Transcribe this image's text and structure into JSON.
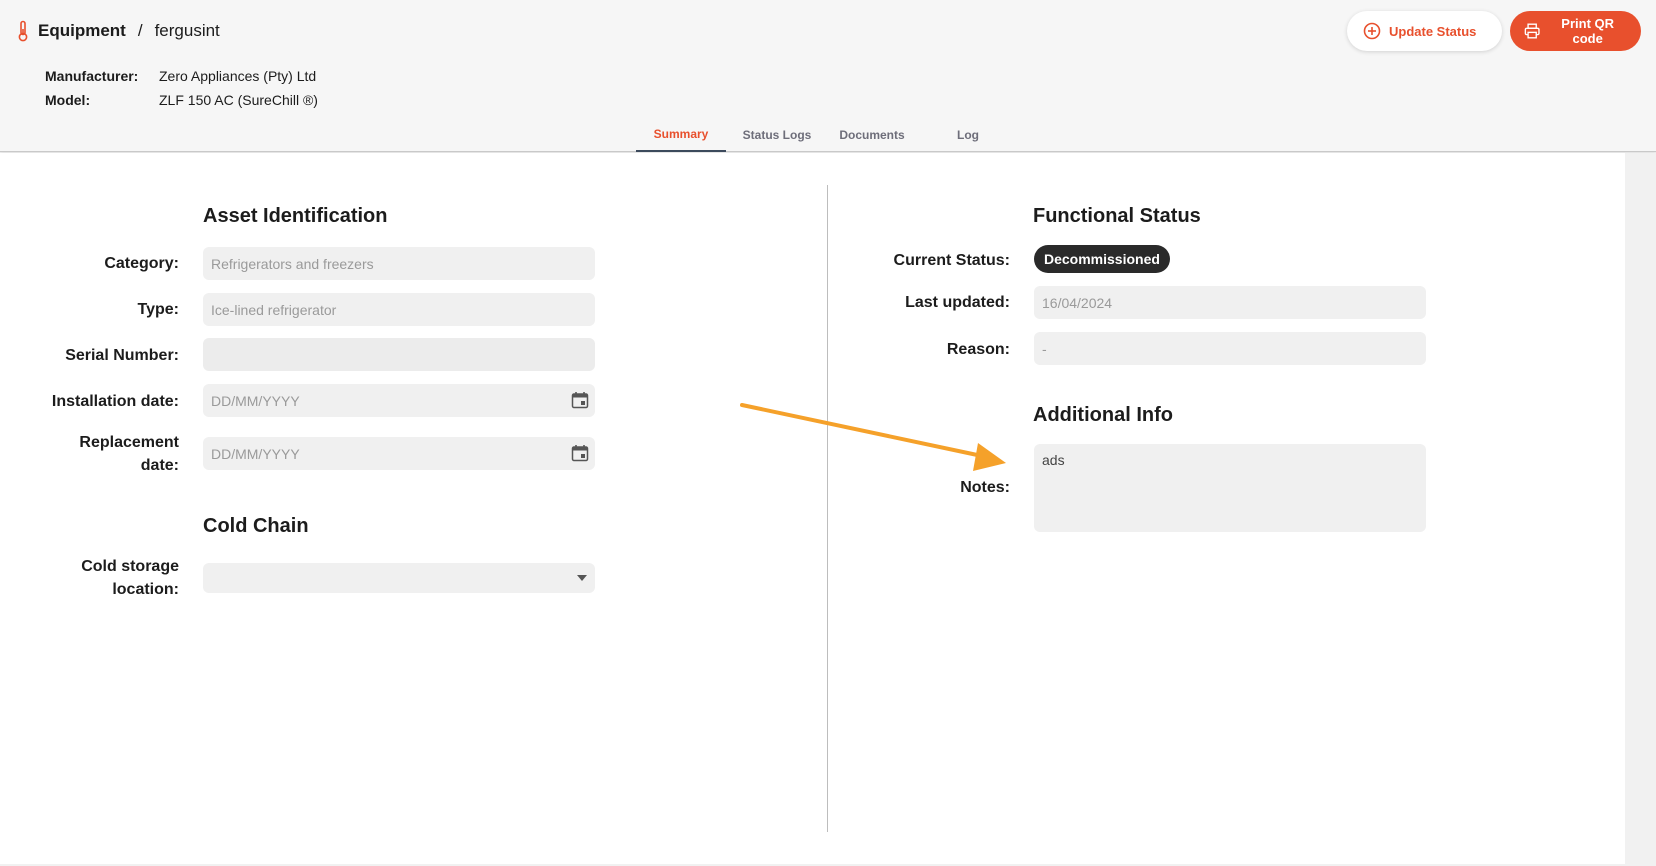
{
  "breadcrumb": {
    "root": "Equipment",
    "separator": "/",
    "current": "fergusint"
  },
  "meta": {
    "manufacturer_label": "Manufacturer:",
    "manufacturer_value": "Zero Appliances (Pty) Ltd",
    "model_label": "Model:",
    "model_value": "ZLF 150 AC (SureChill ®)"
  },
  "actions": {
    "update_status": "Update Status",
    "print_qr": "Print QR code"
  },
  "tabs": [
    {
      "label": "Summary",
      "active": true
    },
    {
      "label": "Status Logs",
      "active": false
    },
    {
      "label": "Documents",
      "active": false
    },
    {
      "label": "Log",
      "active": false
    }
  ],
  "asset": {
    "title": "Asset Identification",
    "category_label": "Category:",
    "category_value": "Refrigerators and freezers",
    "type_label": "Type:",
    "type_value": "Ice-lined refrigerator",
    "serial_label": "Serial Number:",
    "serial_value": "",
    "installation_label": "Installation date:",
    "installation_placeholder": "DD/MM/YYYY",
    "replacement_label_1": "Replacement",
    "replacement_label_2": "date:",
    "replacement_placeholder": "DD/MM/YYYY"
  },
  "cold_chain": {
    "title": "Cold Chain",
    "location_label_1": "Cold storage",
    "location_label_2": "location:",
    "location_value": ""
  },
  "functional": {
    "title": "Functional Status",
    "current_label": "Current Status:",
    "current_value": "Decommissioned",
    "updated_label": "Last updated:",
    "updated_value": "16/04/2024",
    "reason_label": "Reason:",
    "reason_value": "-"
  },
  "additional": {
    "title": "Additional Info",
    "notes_label": "Notes:",
    "notes_value": "ads"
  },
  "colors": {
    "accent": "#e8502d",
    "badge": "#2a2a2a",
    "annotation_arrow": "#f5a12a"
  }
}
